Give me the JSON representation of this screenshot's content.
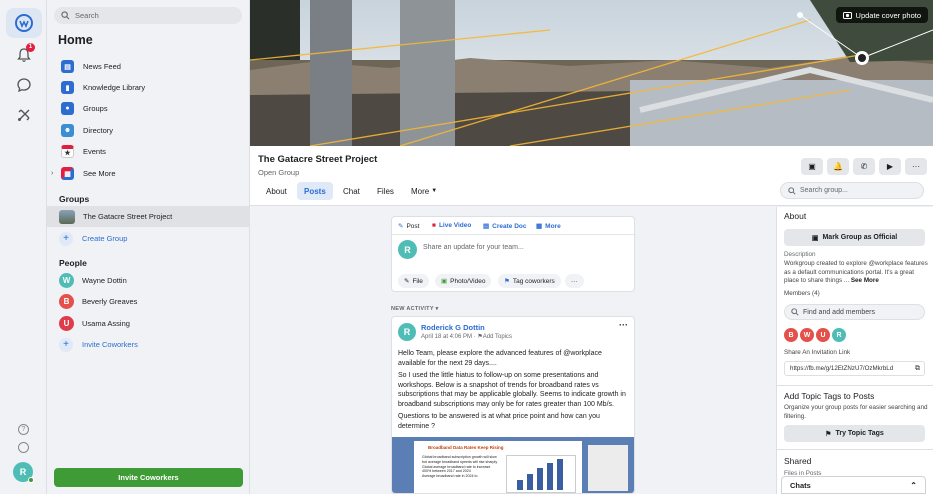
{
  "sidebar": {
    "search_placeholder": "Search",
    "home_title": "Home",
    "nav": [
      {
        "label": "News Feed",
        "icon": "news-feed-icon",
        "color": "#2d6dd1"
      },
      {
        "label": "Knowledge Library",
        "icon": "book-icon",
        "color": "#2d6dd1"
      },
      {
        "label": "Groups",
        "icon": "groups-icon",
        "color": "#2d6dd1"
      },
      {
        "label": "Directory",
        "icon": "directory-icon",
        "color": "#3b8ed1"
      },
      {
        "label": "Events",
        "icon": "calendar-icon",
        "color": "#e41e3f"
      },
      {
        "label": "See More",
        "icon": "grid-icon",
        "color": "#7b68c9"
      }
    ],
    "groups_heading": "Groups",
    "groups": [
      {
        "label": "The Gatacre Street Project"
      }
    ],
    "create_group": "Create Group",
    "people_heading": "People",
    "people": [
      {
        "initial": "W",
        "name": "Wayne Dottin",
        "color": "#4fbdb6"
      },
      {
        "initial": "B",
        "name": "Beverly Greaves",
        "color": "#e4504a"
      },
      {
        "initial": "U",
        "name": "Usama Assing",
        "color": "#e03b4b"
      }
    ],
    "invite_coworkers": "Invite Coworkers",
    "invite_button": "Invite Coworkers"
  },
  "rail": {
    "notification_count": "1",
    "user_initial": "R"
  },
  "cover": {
    "update_label": "Update cover photo"
  },
  "group": {
    "title": "The Gatacre Street Project",
    "subtitle": "Open Group",
    "tabs": [
      "About",
      "Posts",
      "Chat",
      "Files",
      "More"
    ],
    "active_tab": "Posts",
    "search_placeholder": "Search group..."
  },
  "composer": {
    "tabs": [
      "Post",
      "Live Video",
      "Create Doc",
      "More"
    ],
    "placeholder": "Share an update for your team...",
    "user_initial": "R",
    "chips": [
      "File",
      "Photo/Video",
      "Tag coworkers",
      "···"
    ]
  },
  "feed": {
    "new_activity": "NEW ACTIVITY"
  },
  "post": {
    "author": "Roderick G Dottin",
    "author_initial": "R",
    "meta": "April 18 at 4:06 PM ·",
    "add_topics": "Add Topics",
    "paragraphs": [
      "Hello Team, please explore the advanced features of @workplace available for the next 29 days....",
      "So I used the little hiatus to follow-up on some presentations and workshops. Below is a snapshot of trends for broadband rates vs subscriptions that may be applicable globally. Seems to indicate growth in broadband subscriptions may only be for rates greater than 100 Mb/s.",
      "Questions to be answered is at what price point and how can you determine ?"
    ],
    "slide_title": "Broadband Data Rates Keep Rising",
    "slide_bullets": [
      "Global broadband subscription growth will slow but average broadband speeds will rise sharply",
      "Global average broadband rate to increase 400% between 2017 and 2024",
      "Average broadband rate in 2024 to"
    ]
  },
  "about": {
    "heading": "About",
    "mark_official": "Mark Group as Official",
    "desc_label": "Description",
    "desc": "Workgroup created to explore @workplace features as a default communications portal. It's a great place to share things ...",
    "see_more": "See More",
    "members_label": "Members (4)",
    "members_placeholder": "Find and add members",
    "members": [
      {
        "initial": "B",
        "color": "#e4504a"
      },
      {
        "initial": "W",
        "color": "#e4504a"
      },
      {
        "initial": "U",
        "color": "#e4504a"
      },
      {
        "initial": "R",
        "color": "#4fbdb6"
      }
    ],
    "invite_link_label": "Share An Invitation Link",
    "invite_link": "https://fb.me/g/12EtZNzU7/OzMkrbLd",
    "topic_heading": "Add Topic Tags to Posts",
    "topic_desc": "Organize your group posts for easier searching and filtering.",
    "topic_button": "Try Topic Tags",
    "shared_heading": "Shared",
    "shared_sub": "Files in Posts"
  },
  "chats": {
    "label": "Chats"
  },
  "colors": {
    "accent": "#2d6dd1",
    "green": "#3f9b35",
    "alert": "#e41e3f"
  }
}
